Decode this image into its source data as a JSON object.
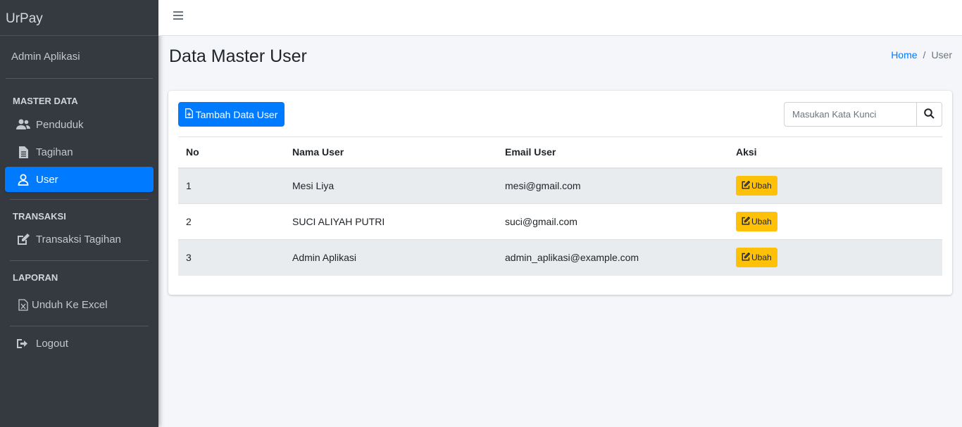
{
  "brand": "UrPay",
  "user_panel": {
    "name": "Admin Aplikasi"
  },
  "sidebar": {
    "sections": [
      {
        "header": "MASTER DATA"
      },
      {
        "header": "TRANSAKSI"
      },
      {
        "header": "LAPORAN"
      }
    ],
    "items": [
      {
        "label": "Penduduk",
        "icon": "users-icon"
      },
      {
        "label": "Tagihan",
        "icon": "file-text-icon"
      },
      {
        "label": "User",
        "icon": "user-icon",
        "active": true
      },
      {
        "label": "Transaksi Tagihan",
        "icon": "edit-icon"
      },
      {
        "label": "Unduh Ke Excel",
        "icon": "file-excel-icon"
      },
      {
        "label": "Logout",
        "icon": "sign-out-icon"
      }
    ]
  },
  "header": {
    "menu_icon": "hamburger-icon"
  },
  "page": {
    "title": "Data Master User",
    "breadcrumb": [
      {
        "label": "Home",
        "link": true
      },
      {
        "label": "User",
        "link": false
      }
    ],
    "breadcrumb_separator": "/"
  },
  "toolbar": {
    "add_label": "Tambah Data User",
    "search_placeholder": "Masukan Kata Kunci"
  },
  "table": {
    "columns": [
      "No",
      "Nama User",
      "Email User",
      "Aksi"
    ],
    "rows": [
      {
        "no": "1",
        "name": "Mesi Liya",
        "email": "mesi@gmail.com",
        "action": "Ubah"
      },
      {
        "no": "2",
        "name": "SUCI ALIYAH PUTRI",
        "email": "suci@gmail.com",
        "action": "Ubah"
      },
      {
        "no": "3",
        "name": "Admin Aplikasi",
        "email": "admin_aplikasi@example.com",
        "action": "Ubah"
      }
    ]
  },
  "colors": {
    "sidebar_bg": "#343a40",
    "primary": "#007bff",
    "warning": "#ffc107",
    "content_bg": "#f4f6f9"
  }
}
